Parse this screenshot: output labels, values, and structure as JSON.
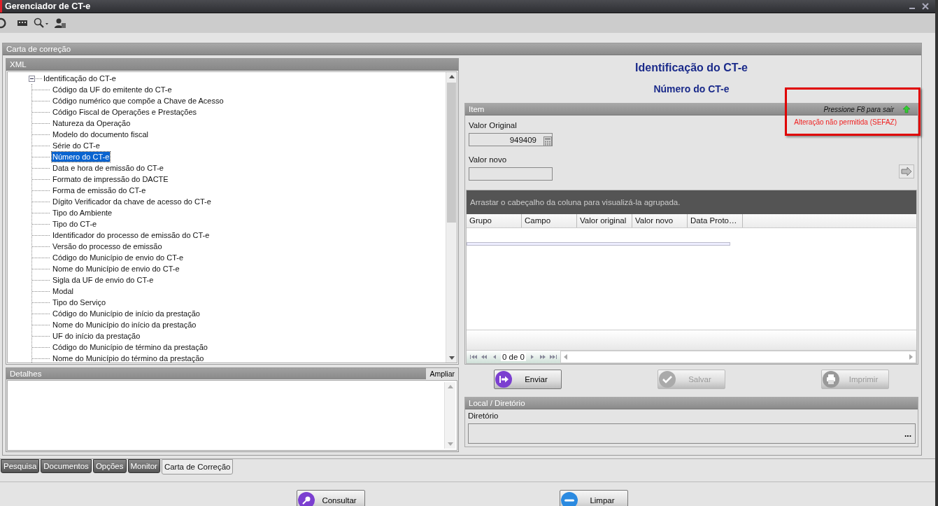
{
  "window": {
    "title": "Gerenciador de CT-e"
  },
  "panel": {
    "title": "Carta de correção"
  },
  "xml": {
    "title": "XML",
    "tree": [
      {
        "label": "Identificação do CT-e",
        "expanded": true,
        "selected": false,
        "children": [
          {
            "label": "Código da UF do emitente do CT-e",
            "selected": false
          },
          {
            "label": "Código numérico que compõe a Chave de Acesso",
            "selected": false
          },
          {
            "label": "Código Fiscal de Operações e Prestações",
            "selected": false
          },
          {
            "label": "Natureza da Operação",
            "selected": false
          },
          {
            "label": "Modelo do documento fiscal",
            "selected": false
          },
          {
            "label": "Série do CT-e",
            "selected": false
          },
          {
            "label": "Número do CT-e",
            "selected": true
          },
          {
            "label": "Data e hora de emissão do CT-e",
            "selected": false
          },
          {
            "label": "Formato de impressão do DACTE",
            "selected": false
          },
          {
            "label": "Forma de emissão do CT-e",
            "selected": false
          },
          {
            "label": "Dígito Verificador da chave de acesso do CT-e",
            "selected": false
          },
          {
            "label": "Tipo do Ambiente",
            "selected": false
          },
          {
            "label": "Tipo do CT-e",
            "selected": false
          },
          {
            "label": "Identificador do processo de emissão do CT-e",
            "selected": false
          },
          {
            "label": "Versão do processo de emissão",
            "selected": false
          },
          {
            "label": "Código do Município de envio do CT-e",
            "selected": false
          },
          {
            "label": "Nome do Município de envio do CT-e",
            "selected": false
          },
          {
            "label": "Sigla da UF de envio do CT-e",
            "selected": false
          },
          {
            "label": "Modal",
            "selected": false
          },
          {
            "label": "Tipo do Serviço",
            "selected": false
          },
          {
            "label": "Código do Município de início da prestação",
            "selected": false
          },
          {
            "label": "Nome do Município do início da prestação",
            "selected": false
          },
          {
            "label": "UF do início da prestação",
            "selected": false
          },
          {
            "label": "Código do Município de término da prestação",
            "selected": false
          },
          {
            "label": "Nome do Município do término da prestação",
            "selected": false
          }
        ]
      }
    ]
  },
  "details": {
    "title": "Detalhes",
    "expand_button": "Ampliar"
  },
  "heading": "Identificação do CT-e",
  "subheading": "Número do CT-e",
  "item": {
    "title": "Item",
    "hint": "Pressione F8 para sair",
    "warning": "Alteração não permitida (SEFAZ)",
    "original_label": "Valor Original",
    "original_value": "949409",
    "new_label": "Valor novo"
  },
  "grid": {
    "group_hint": "Arrastar o cabeçalho da coluna para visualizá-la agrupada.",
    "columns": [
      "Grupo",
      "Campo",
      "Valor original",
      "Valor novo",
      "Data Proto…"
    ],
    "pager": "0 de 0"
  },
  "actions": [
    {
      "kind": "send",
      "label": "Enviar",
      "disabled": false
    },
    {
      "kind": "save",
      "label": "Salvar",
      "disabled": true
    },
    {
      "kind": "print",
      "label": "Imprimir",
      "disabled": true
    }
  ],
  "location": {
    "title": "Local / Diretório",
    "label": "Diretório",
    "browse": "..."
  },
  "tabs": [
    {
      "label": "Pesquisa",
      "selected": false
    },
    {
      "label": "Documentos",
      "selected": false
    },
    {
      "label": "Opções",
      "selected": false
    },
    {
      "label": "Monitor",
      "selected": false
    },
    {
      "label": "Carta de Correção",
      "selected": true
    }
  ],
  "bottom_buttons": [
    {
      "kind": "search",
      "label": "Consultar"
    },
    {
      "kind": "clear",
      "label": "Limpar"
    }
  ]
}
